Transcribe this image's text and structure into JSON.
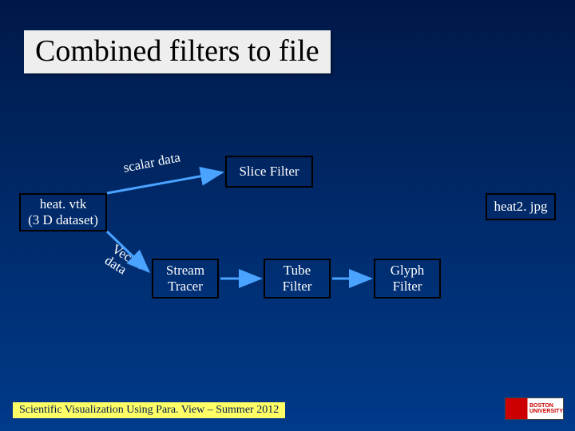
{
  "title": "Combined filters to file",
  "nodes": {
    "source": "heat. vtk\n(3 D dataset)",
    "slice": "Slice Filter",
    "output": "heat2. jpg",
    "stream": "Stream\nTracer",
    "tube": "Tube\nFilter",
    "glyph": "Glyph\nFilter"
  },
  "edges": {
    "scalar": "scalar data",
    "vector": "Vector\ndata"
  },
  "footer": "Scientific Visualization Using Para. View – Summer 2012",
  "logo": "BOSTON\nUNIVERSITY"
}
